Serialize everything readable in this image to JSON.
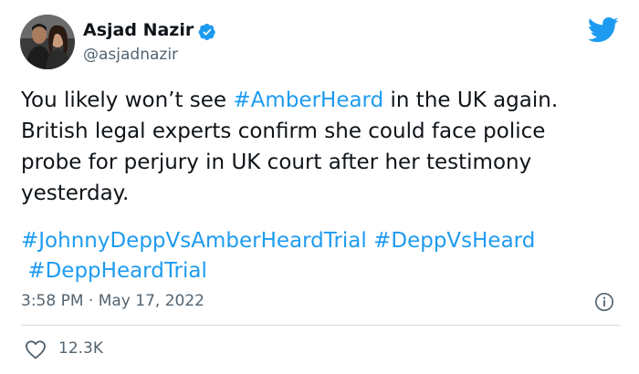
{
  "author": {
    "name": "Asjad Nazir",
    "handle": "@asjadnazir",
    "verified": true
  },
  "tweet": {
    "line1": {
      "pre": "You likely won’t see ",
      "tag": "#AmberHeard",
      "post": " in the UK again."
    },
    "line2": "British legal experts confirm she could face police",
    "line3": "probe for perjury in UK court after her testimony",
    "line4": "yesterday.",
    "hashtags": [
      "#JohnnyDeppVsAmberHeardTrial",
      "#DeppVsHeard",
      "#DeppHeardTrial"
    ]
  },
  "meta": {
    "time": "3:58 PM",
    "separator": "·",
    "date": "May 17, 2022"
  },
  "stats": {
    "likes": "12.3K"
  },
  "colors": {
    "text": "#0f1419",
    "secondary": "#536471",
    "link": "#1d9bf0",
    "verified": "#1d9bf0",
    "twitter_blue": "#1d9bf0",
    "divider": "#cfd9de"
  },
  "icons": [
    "verified-badge-icon",
    "twitter-bird-icon",
    "info-icon",
    "heart-icon"
  ]
}
